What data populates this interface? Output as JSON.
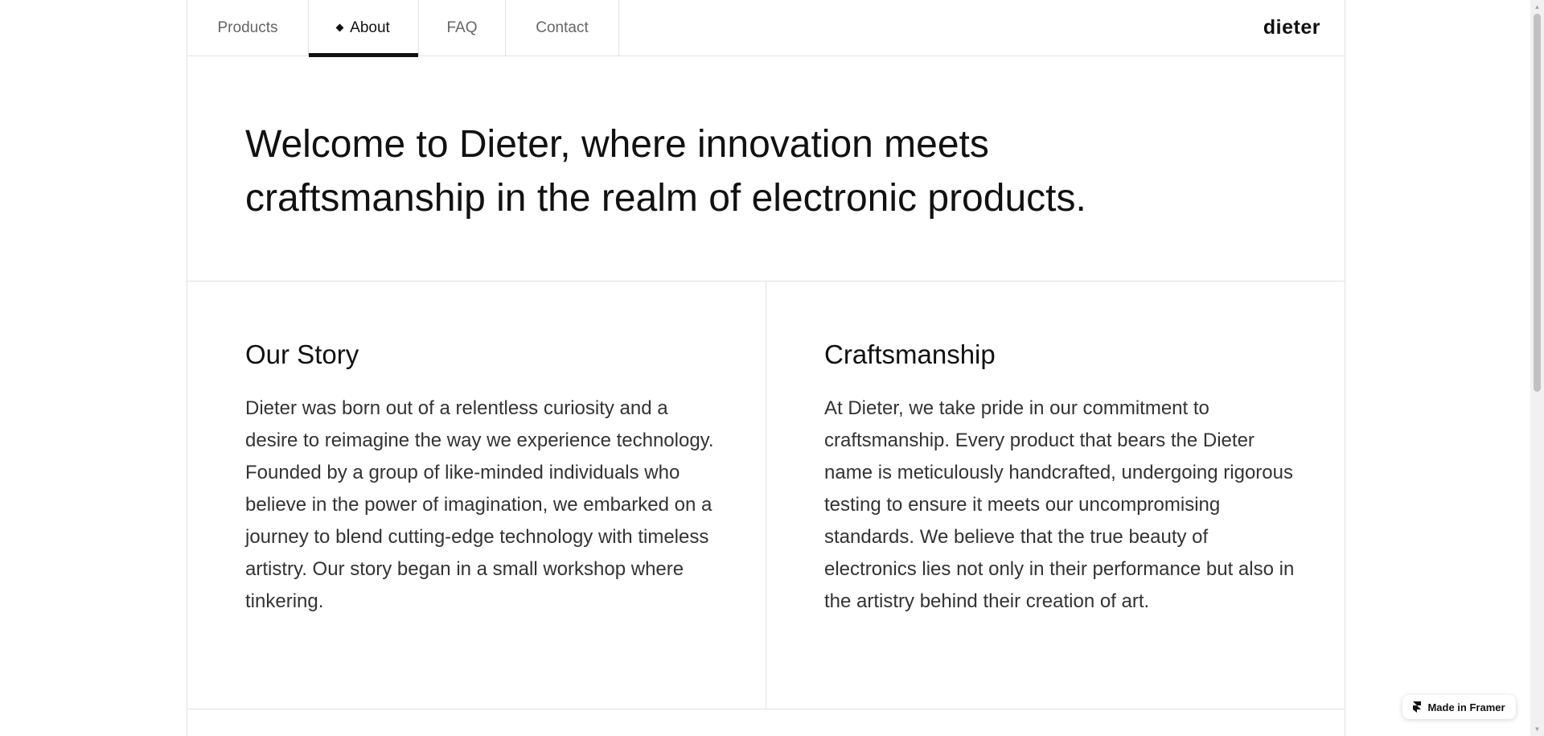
{
  "nav": {
    "tabs": [
      {
        "label": "Products",
        "active": false
      },
      {
        "label": "About",
        "active": true
      },
      {
        "label": "FAQ",
        "active": false
      },
      {
        "label": "Contact",
        "active": false
      }
    ],
    "logo": "dieter"
  },
  "hero": {
    "heading_line1": "Welcome to Dieter, where innovation meets",
    "heading_line2": "craftsmanship in the realm of electronic products."
  },
  "sections": [
    {
      "title": "Our Story",
      "body": "Dieter was born out of a relentless curiosity and a desire to reimagine the way we experience technology. Founded by a group of like-minded individuals who believe in the power of imagination, we embarked on a journey to blend cutting-edge technology with timeless artistry. Our story began in a small workshop where tinkering."
    },
    {
      "title": "Craftsmanship",
      "body": "At Dieter, we take pride in our commitment to craftsmanship. Every product that bears the Dieter name is meticulously handcrafted, undergoing rigorous testing to ensure it meets our uncompromising standards. We believe that the true beauty of electronics lies not only in their performance but also in the artistry behind their creation of art."
    }
  ],
  "badge": {
    "label": "Made in Framer",
    "icon": "framer-icon"
  },
  "colors": {
    "text": "#111111",
    "body_text": "#333333",
    "border": "#e2e2e2",
    "background": "#ffffff"
  }
}
